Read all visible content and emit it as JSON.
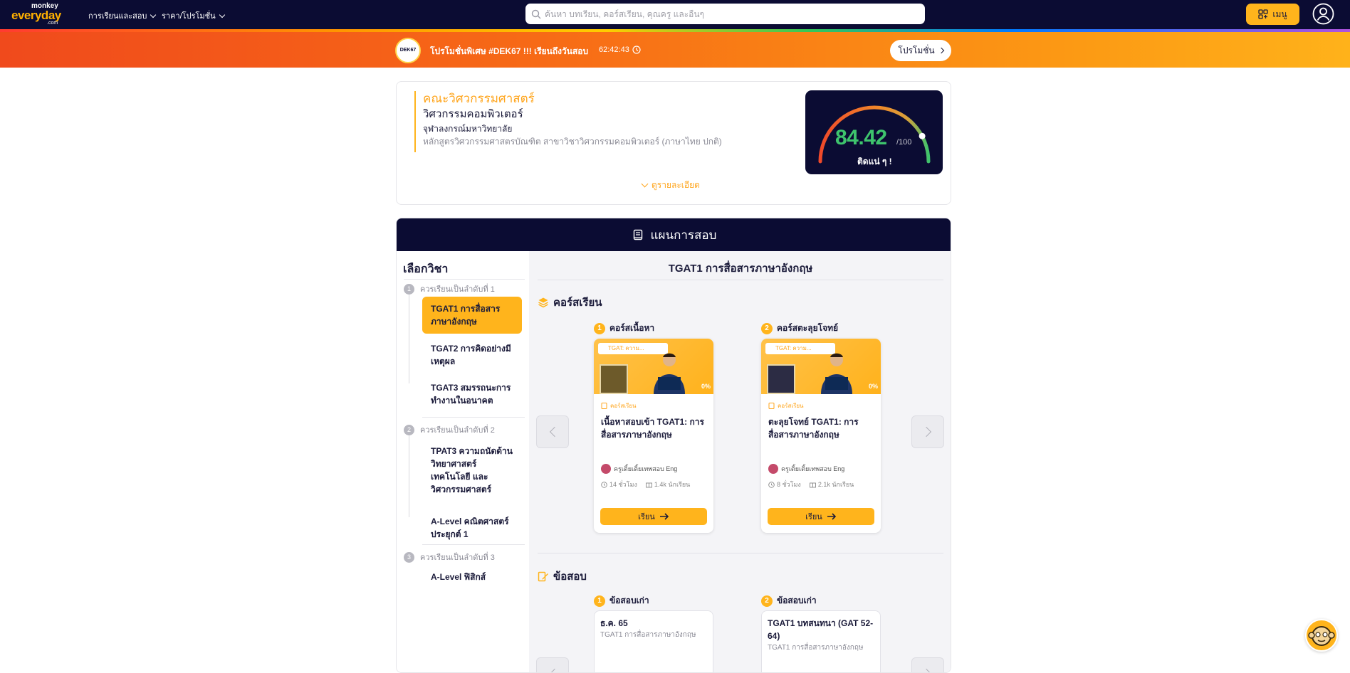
{
  "nav": {
    "logo_top": "monkey",
    "logo_main": "everyday",
    "logo_sub": ".com",
    "links": [
      "การเรียนและสอบ",
      "ราคา/โปรโมชั่น"
    ],
    "search_placeholder": "ค้นหา บทเรียน, คอร์สเรียน, คุณครู และอื่นๆ",
    "menu_label": "เมนู"
  },
  "promo": {
    "logo_text": "DEK67",
    "text": "โปรโมชั่นพิเศษ #DEK67 !!! เรียนถึงวันสอบ",
    "timer": "62:42:43",
    "button_label": "โปรโมชั่น"
  },
  "faculty": {
    "title": "คณะวิศวกรรมศาสตร์",
    "major": "วิศวกรรมคอมพิวเตอร์",
    "university": "จุฬาลงกรณ์มหาวิทยาลัย",
    "program": "หลักสูตรวิศวกรรมศาสตรบัณฑิต สาขาวิชาวิศวกรรมคอมพิวเตอร์ (ภาษาไทย ปกติ)",
    "details_label": "ดูรายละเอียด",
    "score": "84.42",
    "score_max": "/100",
    "score_fraction": 0.8442,
    "score_label": "ติดแน่ ๆ !"
  },
  "plan": {
    "title": "แผนการสอบ",
    "sidebar_title": "เลือกวิชา",
    "groups": [
      {
        "label": "ควรเรียนเป็นลำดับที่ 1",
        "num": "1",
        "subjects": [
          "TGAT1 การสื่อสารภาษาอังกฤษ",
          "TGAT2 การคิดอย่างมีเหตุผล",
          "TGAT3 สมรรถนะการทำงานในอนาคต"
        ]
      },
      {
        "label": "ควรเรียนเป็นลำดับที่ 2",
        "num": "2",
        "subjects": [
          "TPAT3 ความถนัดด้านวิทยาศาสตร์ เทคโนโลยี และวิศวกรรมศาสตร์",
          "A-Level คณิตศาสตร์ประยุกต์ 1"
        ]
      },
      {
        "label": "ควรเรียนเป็นลำดับที่ 3",
        "num": "3",
        "subjects": [
          "A-Level ฟิสิกส์"
        ]
      }
    ],
    "main_title": "TGAT1 การสื่อสารภาษาอังกฤษ",
    "courses_title": "คอร์สเรียน",
    "courses": [
      {
        "num": "1",
        "head": "คอร์สเนื้อหา",
        "tag": "TGAT: ความ...",
        "type": "คอร์สเรียน",
        "title": "เนื้อหาสอบเข้า TGAT1: การสื่อสารภาษาอังกฤษ",
        "teacher": "ครูเติ้ยเติ้ยเทพสอบ Eng",
        "hours": "14 ชั่วโมง",
        "students": "1.4k นักเรียน",
        "progress": "0%",
        "btn": "เรียน"
      },
      {
        "num": "2",
        "head": "คอร์สตะลุยโจทย์",
        "tag": "TGAT: ความ...",
        "type": "คอร์สเรียน",
        "title": "ตะลุยโจทย์ TGAT1: การสื่อสารภาษาอังกฤษ",
        "teacher": "ครูเติ้ยเติ้ยเทพสอบ Eng",
        "hours": "8 ชั่วโมง",
        "students": "2.1k นักเรียน",
        "progress": "0%",
        "btn": "เรียน"
      }
    ],
    "exams_title": "ข้อสอบ",
    "exams": [
      {
        "num": "1",
        "head": "ข้อสอบเก่า",
        "title": "ธ.ค. 65",
        "sub": "TGAT1 การสื่อสารภาษาอังกฤษ"
      },
      {
        "num": "2",
        "head": "ข้อสอบเก่า",
        "title": "TGAT1 บทสนทนา (GAT 52-64)",
        "sub": "TGAT1 การสื่อสารภาษาอังกฤษ"
      }
    ]
  },
  "colors": {
    "navy": "#0b0c33",
    "accent": "#ffb41c",
    "orange_text": "#ffa51c",
    "score_green": "#3ec46d"
  }
}
